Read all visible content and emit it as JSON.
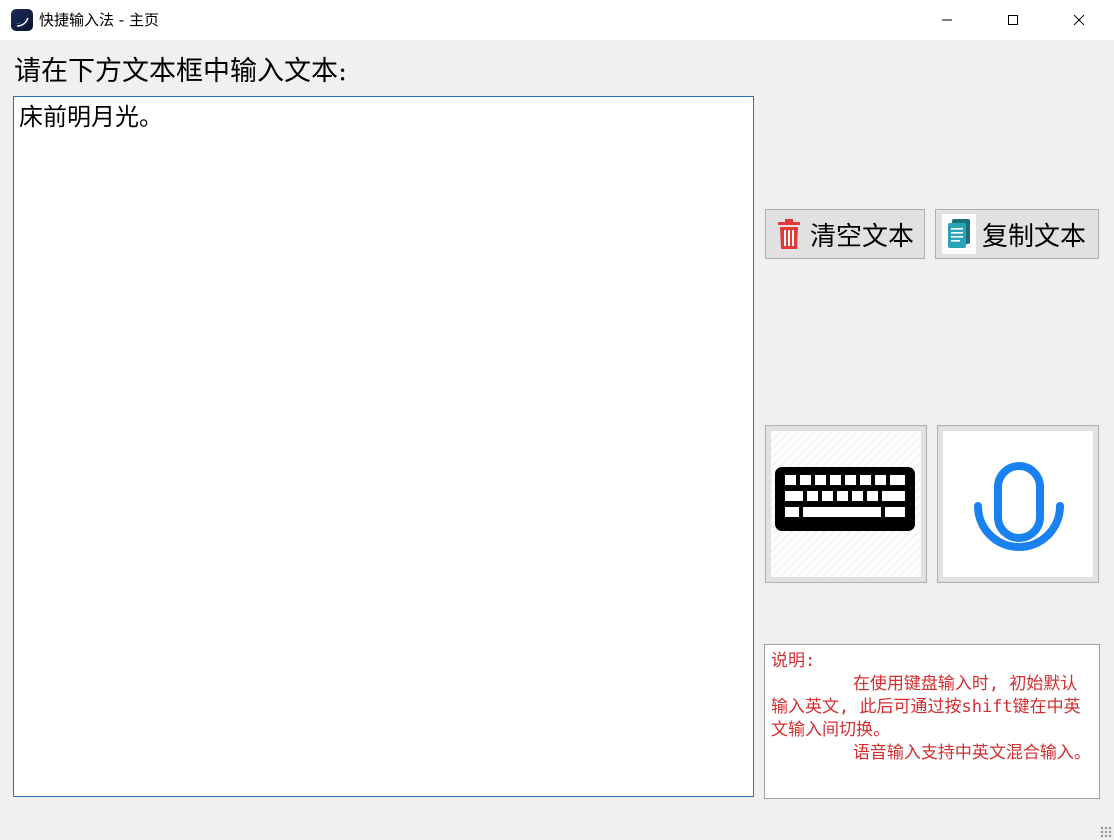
{
  "window": {
    "title": "快捷输入法 - 主页",
    "controls": [
      "minimize",
      "maximize",
      "close"
    ]
  },
  "prompt": "请在下方文本框中输入文本:",
  "editor": {
    "value": "床前明月光。"
  },
  "buttons": {
    "clear": {
      "label": "清空文本",
      "icon": "trash-icon",
      "icon_color": "#e53935"
    },
    "copy": {
      "label": "复制文本",
      "icon": "document-copy-icon",
      "icon_color": "#1e8aa0"
    }
  },
  "mode_buttons": {
    "keyboard": {
      "icon": "keyboard-icon",
      "color": "#000000"
    },
    "voice": {
      "icon": "microphone-icon",
      "color": "#1a82f0"
    }
  },
  "info": {
    "text": "说明:\n        在使用键盘输入时, 初始默认输入英文, 此后可通过按shift键在中英文输入间切换。\n        语音输入支持中英文混合输入。",
    "color": "#d32f2f"
  }
}
